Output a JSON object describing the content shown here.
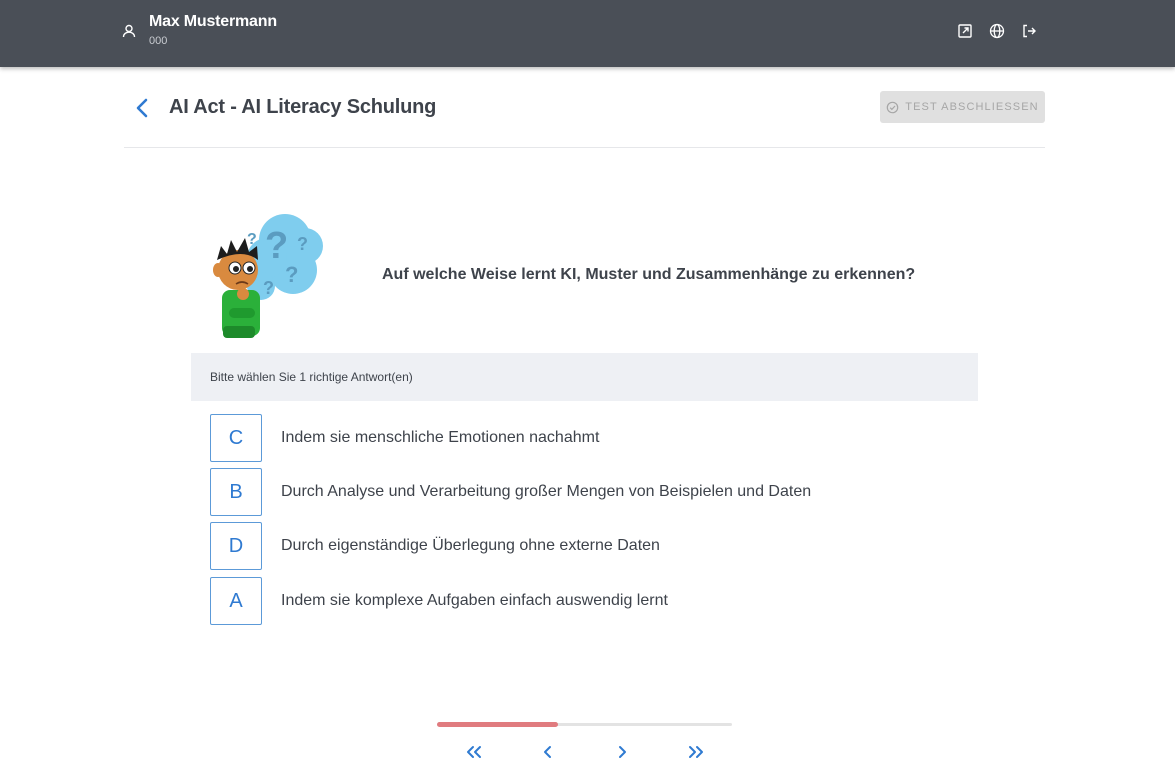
{
  "header": {
    "user_name": "Max Mustermann",
    "user_id": "000",
    "icons": [
      "open-external-icon",
      "globe-icon",
      "logout-icon"
    ]
  },
  "course": {
    "title": "AI Act - AI Literacy Schulung",
    "finish_button_label": "TEST ABSCHLIESSEN",
    "finish_button_enabled": false
  },
  "question": {
    "text": "Auf welche Weise lernt KI, Muster und Zusammenhänge zu erkennen?",
    "instruction": "Bitte wählen Sie 1 richtige Antwort(en)",
    "answers": [
      {
        "letter": "C",
        "text": "Indem sie menschliche Emotionen nachahmt"
      },
      {
        "letter": "B",
        "text": "Durch Analyse und Verarbeitung großer Mengen von Beispielen und Daten"
      },
      {
        "letter": "D",
        "text": "Durch eigenständige Überlegung ohne externe Daten"
      },
      {
        "letter": "A",
        "text": "Indem sie komplexe Aufgaben einfach auswendig lernt"
      }
    ]
  },
  "progress": {
    "fraction": 0.41
  },
  "navigation": {
    "icons": [
      "first-page-icon",
      "previous-icon",
      "next-icon",
      "last-page-icon"
    ]
  },
  "colors": {
    "topbar": "#4a4f57",
    "accent": "#2f7ad1",
    "progress_fill": "#e07b7f"
  }
}
